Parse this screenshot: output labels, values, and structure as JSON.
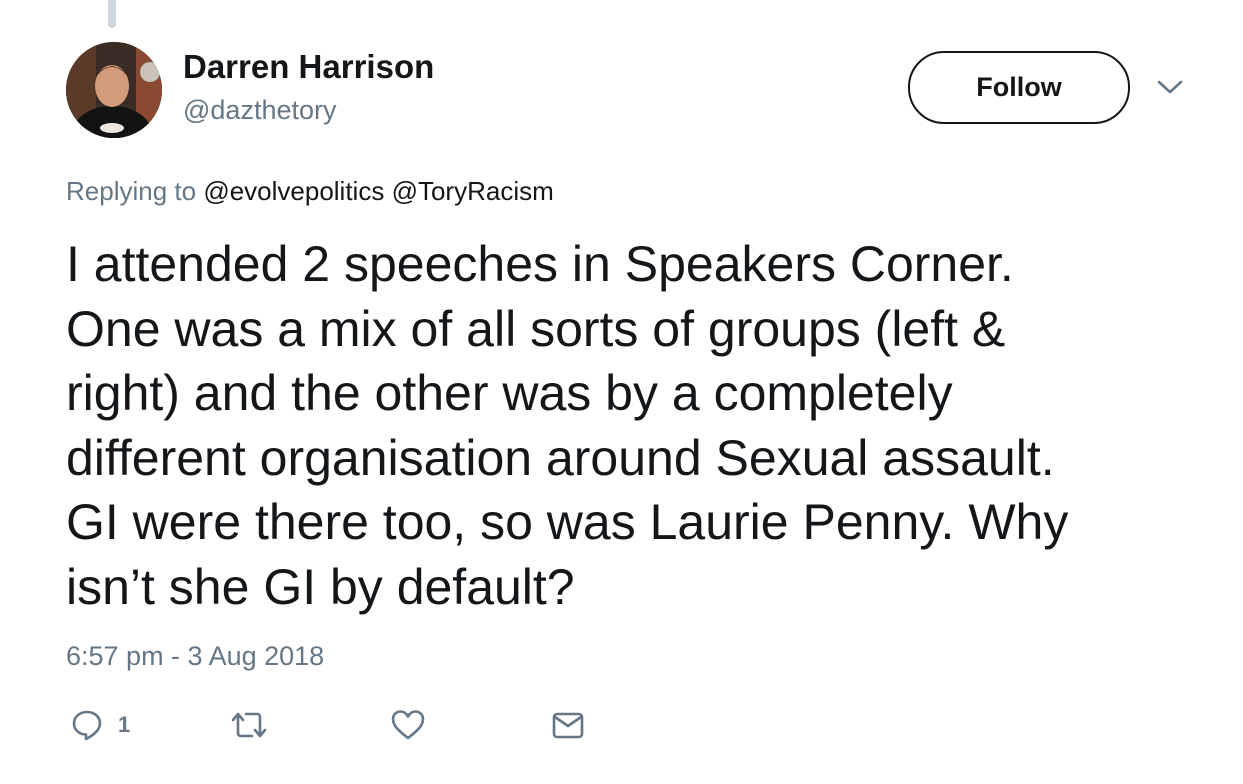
{
  "tweet": {
    "author": {
      "display_name": "Darren Harrison",
      "handle": "@dazthetory",
      "avatar_icon": "profile-photo"
    },
    "follow_label": "Follow",
    "caret_icon": "chevron-down-icon",
    "replying": {
      "prefix": "Replying to",
      "mentions": [
        "@evolvepolitics",
        "@ToryRacism"
      ]
    },
    "text_lines": [
      "I attended 2 speeches in Speakers Corner.",
      "One was a mix of all sorts of groups (left &",
      "right) and the other was by a completely",
      "different organisation around Sexual assault.",
      "GI were there too, so was Laurie Penny. Why",
      "isn’t she GI by default?"
    ],
    "timestamp": "6:57 pm - 3 Aug 2018",
    "actions": {
      "reply_count": "1",
      "icons": [
        "reply-icon",
        "retweet-icon",
        "like-icon",
        "direct-message-icon"
      ]
    }
  },
  "colors": {
    "text_primary": "#14171a",
    "text_secondary": "#657786",
    "thread_line": "#ccd6dd"
  }
}
